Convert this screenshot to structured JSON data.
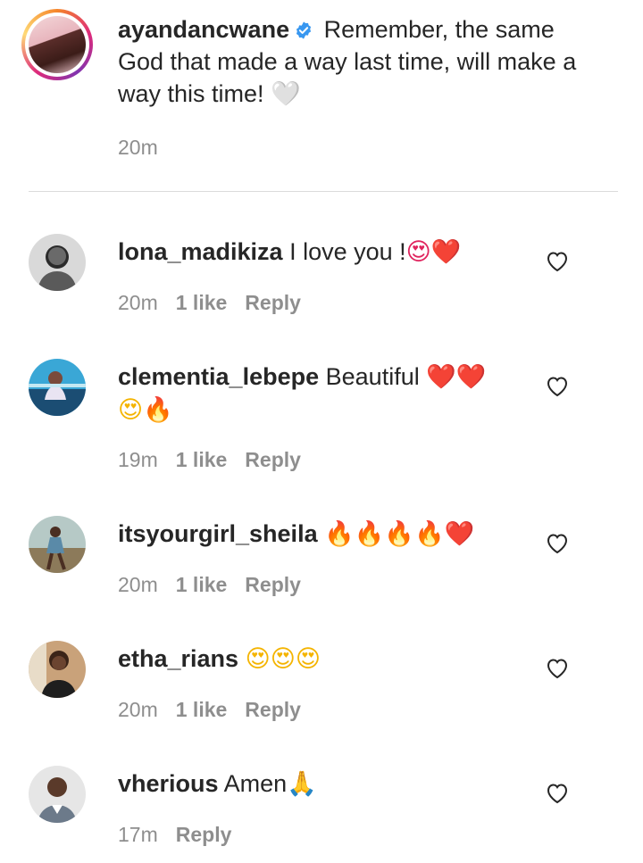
{
  "caption": {
    "username": "ayandancwane",
    "verified_icon": "verified-badge-icon",
    "text": "Remember, the same God that made a way last time, will make a way this time!",
    "emoji": "🤍",
    "time": "20m"
  },
  "comments": [
    {
      "username": "lona_madikiza",
      "text": "I love you !",
      "emojis": "😍❤️",
      "time": "20m",
      "likes": "1 like",
      "reply": "Reply"
    },
    {
      "username": "clementia_lebepe",
      "text": "Beautiful",
      "emojis": "❤️❤️",
      "emojis_line2": "😍🔥",
      "time": "19m",
      "likes": "1 like",
      "reply": "Reply"
    },
    {
      "username": "itsyourgirl_sheila",
      "text": "",
      "emojis": "🔥🔥🔥🔥❤️",
      "time": "20m",
      "likes": "1 like",
      "reply": "Reply"
    },
    {
      "username": "etha_rians",
      "text": "",
      "emojis": "😍😍😍",
      "time": "20m",
      "likes": "1 like",
      "reply": "Reply"
    },
    {
      "username": "vherious",
      "text": "Amen",
      "emojis": "🙏",
      "time": "17m",
      "reply": "Reply"
    }
  ]
}
